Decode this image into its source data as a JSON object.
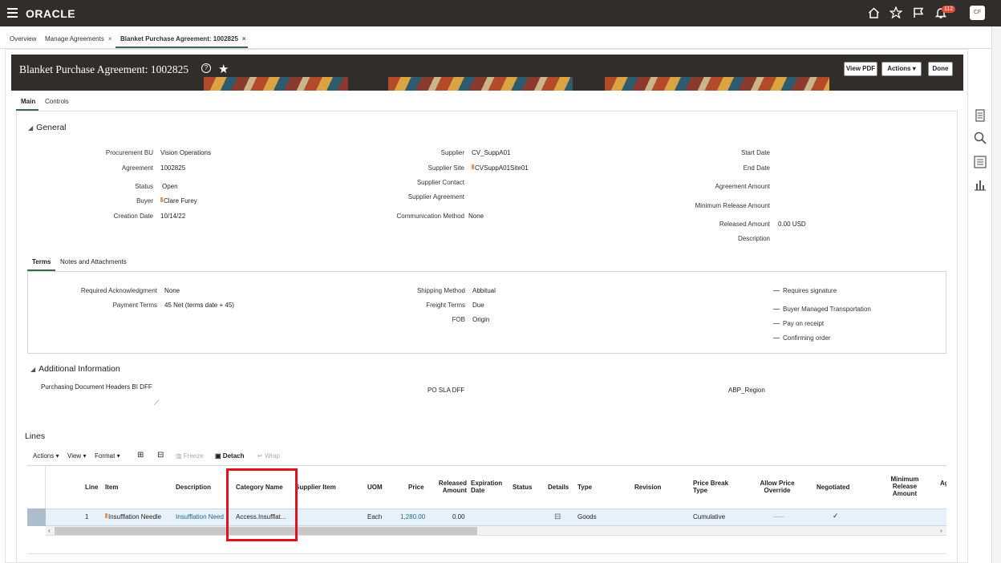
{
  "app": {
    "brand": "ORACLE",
    "notification_count": "112",
    "user_initials": "CF"
  },
  "tabs": [
    {
      "label": "Overview"
    },
    {
      "label": "Manage Agreements"
    },
    {
      "label": "Blanket Purchase Agreement: 1002825"
    }
  ],
  "header": {
    "title": "Blanket Purchase Agreement: 1002825",
    "help": "?",
    "view_pdf": "View PDF",
    "actions": "Actions",
    "done": "Done"
  },
  "subtabs": {
    "main": "Main",
    "controls": "Controls"
  },
  "general": {
    "title": "General",
    "procurement_bu": {
      "label": "Procurement BU",
      "value": "Vision Operations"
    },
    "agreement": {
      "label": "Agreement",
      "value": "1002825"
    },
    "status": {
      "label": "Status",
      "value": "Open"
    },
    "buyer": {
      "label": "Buyer",
      "value": "Clare Furey"
    },
    "creation_date": {
      "label": "Creation Date",
      "value": "10/14/22"
    },
    "supplier": {
      "label": "Supplier",
      "value": "CV_SuppA01"
    },
    "supplier_site": {
      "label": "Supplier Site",
      "value": "CVSuppA01Site01"
    },
    "supplier_contact": {
      "label": "Supplier Contact"
    },
    "supplier_agreement": {
      "label": "Supplier Agreement"
    },
    "communication_method": {
      "label": "Communication Method",
      "value": "None"
    },
    "start_date": {
      "label": "Start Date"
    },
    "end_date": {
      "label": "End Date"
    },
    "agreement_amount": {
      "label": "Agreement Amount"
    },
    "minimum_release_amount": {
      "label": "Minimum Release Amount"
    },
    "released_amount": {
      "label": "Released Amount",
      "value": "0.00 USD"
    },
    "description": {
      "label": "Description"
    }
  },
  "terms_tabs": {
    "terms": "Terms",
    "notes": "Notes and Attachments"
  },
  "terms": {
    "required_ack": {
      "label": "Required Acknowledgment",
      "value": "None"
    },
    "payment_terms": {
      "label": "Payment Terms",
      "value": "45 Net (terms date + 45)"
    },
    "shipping_method": {
      "label": "Shipping Method",
      "value": "Abbitual"
    },
    "freight_terms": {
      "label": "Freight Terms",
      "value": "Due"
    },
    "fob": {
      "label": "FOB",
      "value": "Origin"
    },
    "checks": [
      "Requires signature",
      "Buyer Managed Transportation",
      "Pay on receipt",
      "Confirming order"
    ]
  },
  "additional": {
    "title": "Additional Information",
    "dff1": "Purchasing Document Headers BI DFF",
    "dff2": "PO SLA DFF",
    "dff3": "ABP_Region"
  },
  "lines": {
    "title": "Lines",
    "toolbar": {
      "actions": "Actions",
      "view": "View",
      "format": "Format",
      "freeze": "Freeze",
      "detach": "Detach",
      "wrap": "Wrap"
    },
    "columns": {
      "line": "Line",
      "item": "Item",
      "description": "Description",
      "category": "Category Name",
      "supplier_item": "Supplier Item",
      "uom": "UOM",
      "price": "Price",
      "released_amount": "Released Amount",
      "expiration_date": "Expiration Date",
      "status": "Status",
      "details": "Details",
      "type": "Type",
      "revision": "Revision",
      "price_break_type": "Price Break Type",
      "allow_price_override": "Allow Price Override",
      "negotiated": "Negotiated",
      "minimum_release_amount": "Minimum Release Amount",
      "ag": "Ag"
    },
    "row": {
      "line": "1",
      "item": "Insufflation Needle",
      "description": "Insufflation Need",
      "category": "Access.Insufflat...",
      "uom": "Each",
      "price": "1,280.00",
      "released_amount": "0.00",
      "type": "Goods",
      "price_break_type": "Cumulative",
      "allow_override": "___",
      "negotiated": "✓"
    }
  },
  "colors": {
    "topbar": "#312d2a",
    "accent": "#3a6b4e",
    "highlight": "#e0131c",
    "link": "#1f6a8a"
  }
}
